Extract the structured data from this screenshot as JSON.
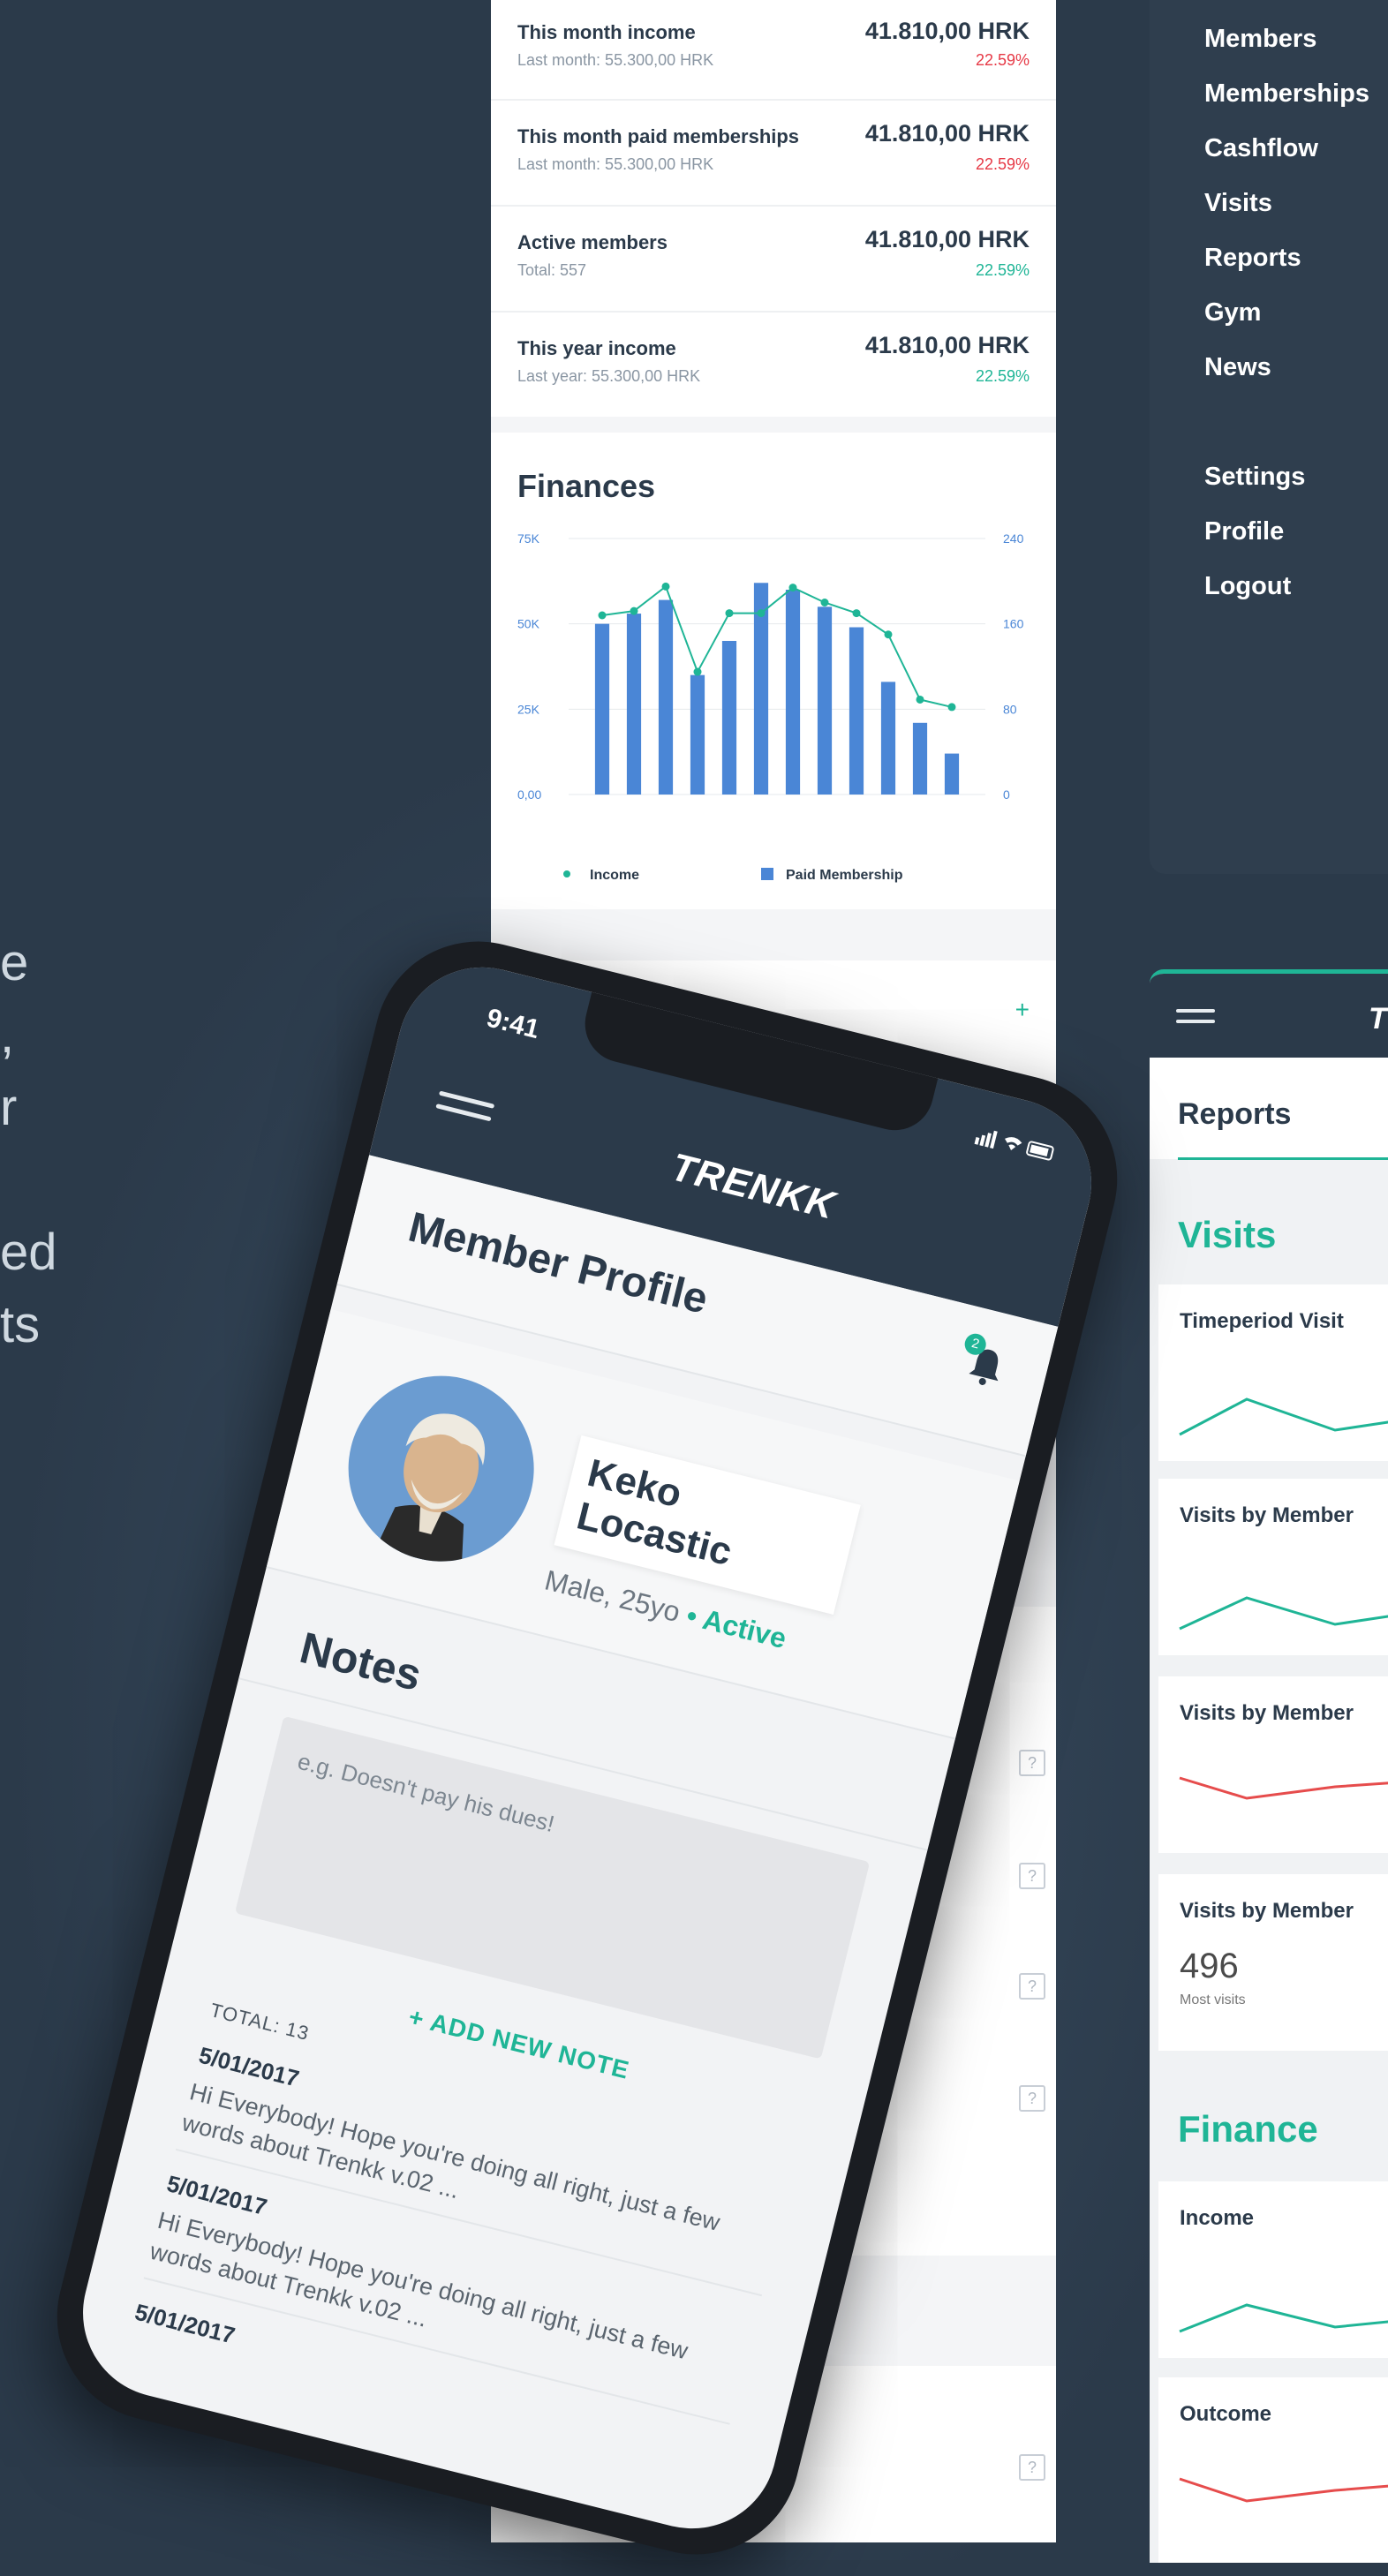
{
  "left_caption": [
    "e",
    ",",
    "r",
    "",
    "ed",
    "ts"
  ],
  "dashboard": {
    "stats": [
      {
        "label": "This month income",
        "sub": "Last month: 55.300,00 HRK",
        "value": "41.810,00 HRK",
        "pct": "22.59%",
        "trend": "red"
      },
      {
        "label": "This month paid memberships",
        "sub": "Last month: 55.300,00 HRK",
        "value": "41.810,00 HRK",
        "pct": "22.59%",
        "trend": "red"
      },
      {
        "label": "Active members",
        "sub": "Total: 557",
        "value": "41.810,00 HRK",
        "pct": "22.59%",
        "trend": "green"
      },
      {
        "label": "This year income",
        "sub": "Last year: 55.300,00 HRK",
        "value": "41.810,00 HRK",
        "pct": "22.59%",
        "trend": "green"
      }
    ],
    "finances_title": "Finances",
    "plus": "+"
  },
  "chart_data": {
    "type": "bar",
    "title": "Finances",
    "y_left_ticks": [
      "75K",
      "50K",
      "25K",
      "0,00"
    ],
    "y_right_ticks": [
      "240",
      "160",
      "80",
      "0"
    ],
    "ylim_left": [
      0,
      75000
    ],
    "ylim_right": [
      0,
      240
    ],
    "series": [
      {
        "name": "Paid Membership",
        "kind": "bar",
        "color": "#4a86d6",
        "axis": "left",
        "values": [
          50000,
          53000,
          57000,
          35000,
          45000,
          62000,
          60000,
          55000,
          49000,
          33000,
          21000,
          12000
        ]
      },
      {
        "name": "Income",
        "kind": "line",
        "color": "#1fb596",
        "axis": "right",
        "values": [
          168,
          172,
          195,
          115,
          170,
          170,
          194,
          180,
          170,
          150,
          89,
          82
        ]
      }
    ],
    "legend": [
      "Income",
      "Paid Membership"
    ]
  },
  "sidebar": {
    "items": [
      "Members",
      "Memberships",
      "Cashflow",
      "Visits",
      "Reports",
      "Gym",
      "News"
    ],
    "bottom_items": [
      "Settings",
      "Profile",
      "Logout"
    ]
  },
  "reports": {
    "logo": "T",
    "title": "Reports",
    "visits_section": "Visits",
    "finance_section": "Finance",
    "cards": [
      "Timeperiod Visit",
      "Visits by Member",
      "Visits by Member",
      "Visits by Member"
    ],
    "count_value": "496",
    "count_label": "Most visits",
    "finance_cards": [
      "Income",
      "Outcome"
    ],
    "colors": {
      "teal": "#1fb596",
      "red": "#e64c4c"
    }
  },
  "phone": {
    "time": "9:41",
    "status_icons": "signal-wifi-battery",
    "logo": "TRENKK",
    "title": "Member Profile",
    "badge": "2",
    "member_name": "Keko Locastic",
    "member_meta": "Male, 25yo",
    "member_status": "Active",
    "notes_title": "Notes",
    "notes_placeholder": "e.g. Doesn't pay his dues!",
    "add_note": "+ ADD NEW NOTE",
    "total": "TOTAL: 13",
    "notes": [
      {
        "date": "5/01/2017",
        "text": "Hi Everybody! Hope you're doing all right, just a few words about Trenkk v.02 ..."
      },
      {
        "date": "5/01/2017",
        "text": "Hi Everybody! Hope you're doing all right, just a few words about Trenkk v.02 ..."
      },
      {
        "date": "5/01/2017",
        "text": ""
      }
    ]
  }
}
